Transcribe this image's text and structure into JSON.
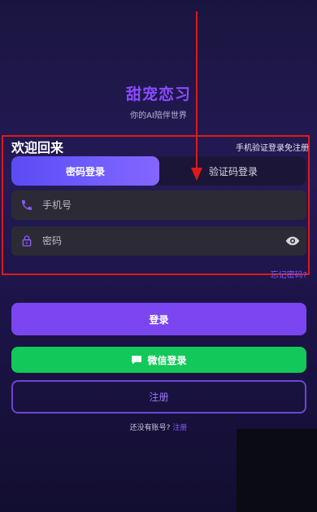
{
  "app": {
    "title": "甜宠恋习",
    "subtitle": "你的AI陪伴世界"
  },
  "login_card": {
    "welcome": "欢迎回来",
    "sms_hint": "手机验证登录免注册",
    "tabs": [
      {
        "label": "密码登录",
        "active": true
      },
      {
        "label": "验证码登录",
        "active": false
      }
    ],
    "phone_placeholder": "手机号",
    "password_placeholder": "密码",
    "forgot": "忘记密码?"
  },
  "buttons": {
    "login": "登录",
    "wechat": "微信登录",
    "register": "注册"
  },
  "footer": {
    "question": "还没有账号?",
    "register_link": "注册"
  },
  "colors": {
    "accent": "#7b45ef",
    "wechat": "#13c85a",
    "highlight": "#e01818"
  },
  "icons": [
    "phone-icon",
    "lock-icon",
    "eye-icon",
    "chat-bubble-icon",
    "arrow-annotation"
  ]
}
